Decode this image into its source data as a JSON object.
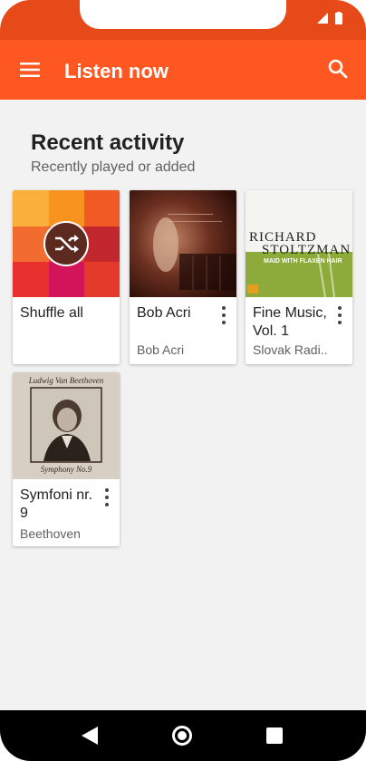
{
  "appbar": {
    "title": "Listen now",
    "menu_icon": "menu-icon",
    "search_icon": "search-icon"
  },
  "section": {
    "heading": "Recent activity",
    "subheading": "Recently played or added"
  },
  "cards": [
    {
      "title": "Shuffle all",
      "subtitle": "",
      "icon": "shuffle-icon"
    },
    {
      "title": "Bob Acri",
      "subtitle": "Bob Acri"
    },
    {
      "title": "Fine Music, Vol. 1",
      "subtitle": "Slovak Radi..",
      "art_text": {
        "line1": "RICHARD",
        "line2": "STOLTZMAN",
        "line3": "MAID WITH FLAXEN HAIR"
      }
    },
    {
      "title": "Symfoni nr. 9",
      "subtitle": "Beethoven",
      "art_text": {
        "top": "Ludwig Van Beethoven",
        "bottom": "Symphony No.9"
      }
    }
  ],
  "navbar": {
    "back_icon": "back-icon",
    "home_icon": "home-icon",
    "recents_icon": "recents-icon"
  },
  "colors": {
    "status_bar": "#e64a19",
    "app_bar": "#ff5722",
    "background": "#f2f2f2"
  }
}
